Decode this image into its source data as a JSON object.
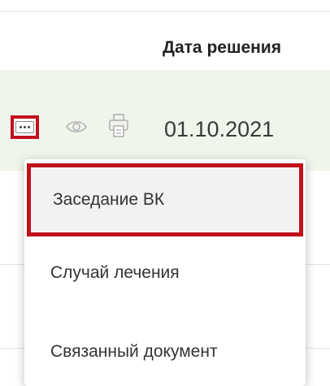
{
  "table": {
    "header": {
      "decision_date": "Дата решения"
    },
    "row": {
      "decision_date": "01.10.2021"
    },
    "accent_highlight": "#c0101c",
    "row_background": "#f0f5ec"
  },
  "row_actions": {
    "more_icon": "more-dots-icon",
    "view_icon": "eye-icon",
    "print_icon": "printer-icon"
  },
  "context_menu": {
    "items": [
      {
        "label": "Заседание ВК",
        "selected": true
      },
      {
        "label": "Случай лечения",
        "selected": false
      },
      {
        "label": "Связанный документ",
        "selected": false
      }
    ]
  }
}
